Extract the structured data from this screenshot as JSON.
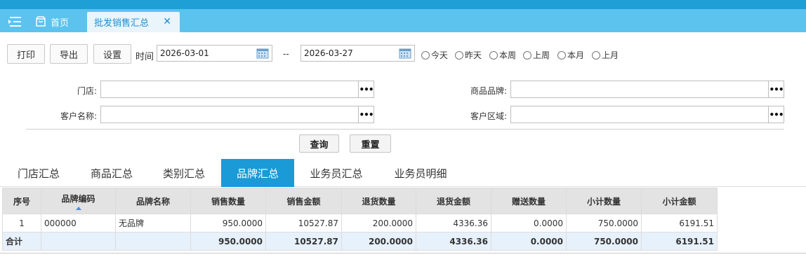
{
  "tabbar": {
    "home_label": "首页",
    "active_tab_label": "批发销售汇总",
    "close_glyph": "✕",
    "menu_icon": "menu-collapse-icon",
    "home_icon": "home-icon"
  },
  "toolbar": {
    "print_label": "打印",
    "export_label": "导出",
    "settings_label": "设置",
    "time_label": "时间",
    "date_from": "2026-03-01",
    "date_sep": "--",
    "date_to": "2026-03-27",
    "ranges": [
      "今天",
      "昨天",
      "本周",
      "上周",
      "本月",
      "上月"
    ]
  },
  "filters": {
    "store_label": "门店:",
    "brand_label": "商品品牌:",
    "customer_label": "客户名称:",
    "region_label": "客户区域:",
    "store_value": "",
    "brand_value": "",
    "customer_value": "",
    "region_value": "",
    "picker_glyph": "•••",
    "query_label": "查询",
    "reset_label": "重置"
  },
  "tabs": {
    "items": [
      "门店汇总",
      "商品汇总",
      "类别汇总",
      "品牌汇总",
      "业务员汇总",
      "业务员明细"
    ],
    "active_index": 3
  },
  "table": {
    "columns": [
      "序号",
      "品牌编码",
      "品牌名称",
      "销售数量",
      "销售金额",
      "退货数量",
      "退货金额",
      "赠送数量",
      "小计数量",
      "小计金额"
    ],
    "rows": [
      [
        "1",
        "000000",
        "无品牌",
        "950.0000",
        "10527.87",
        "200.0000",
        "4336.36",
        "0.0000",
        "750.0000",
        "6191.51"
      ]
    ],
    "total": [
      "合计",
      "",
      "",
      "950.0000",
      "10527.87",
      "200.0000",
      "4336.36",
      "0.0000",
      "750.0000",
      "6191.51"
    ]
  },
  "colors": {
    "topbar": "#1e9fd6",
    "tabbar": "#5cc3ee",
    "active_tab": "#1a9ad6",
    "total_row": "#e7f1fb"
  }
}
